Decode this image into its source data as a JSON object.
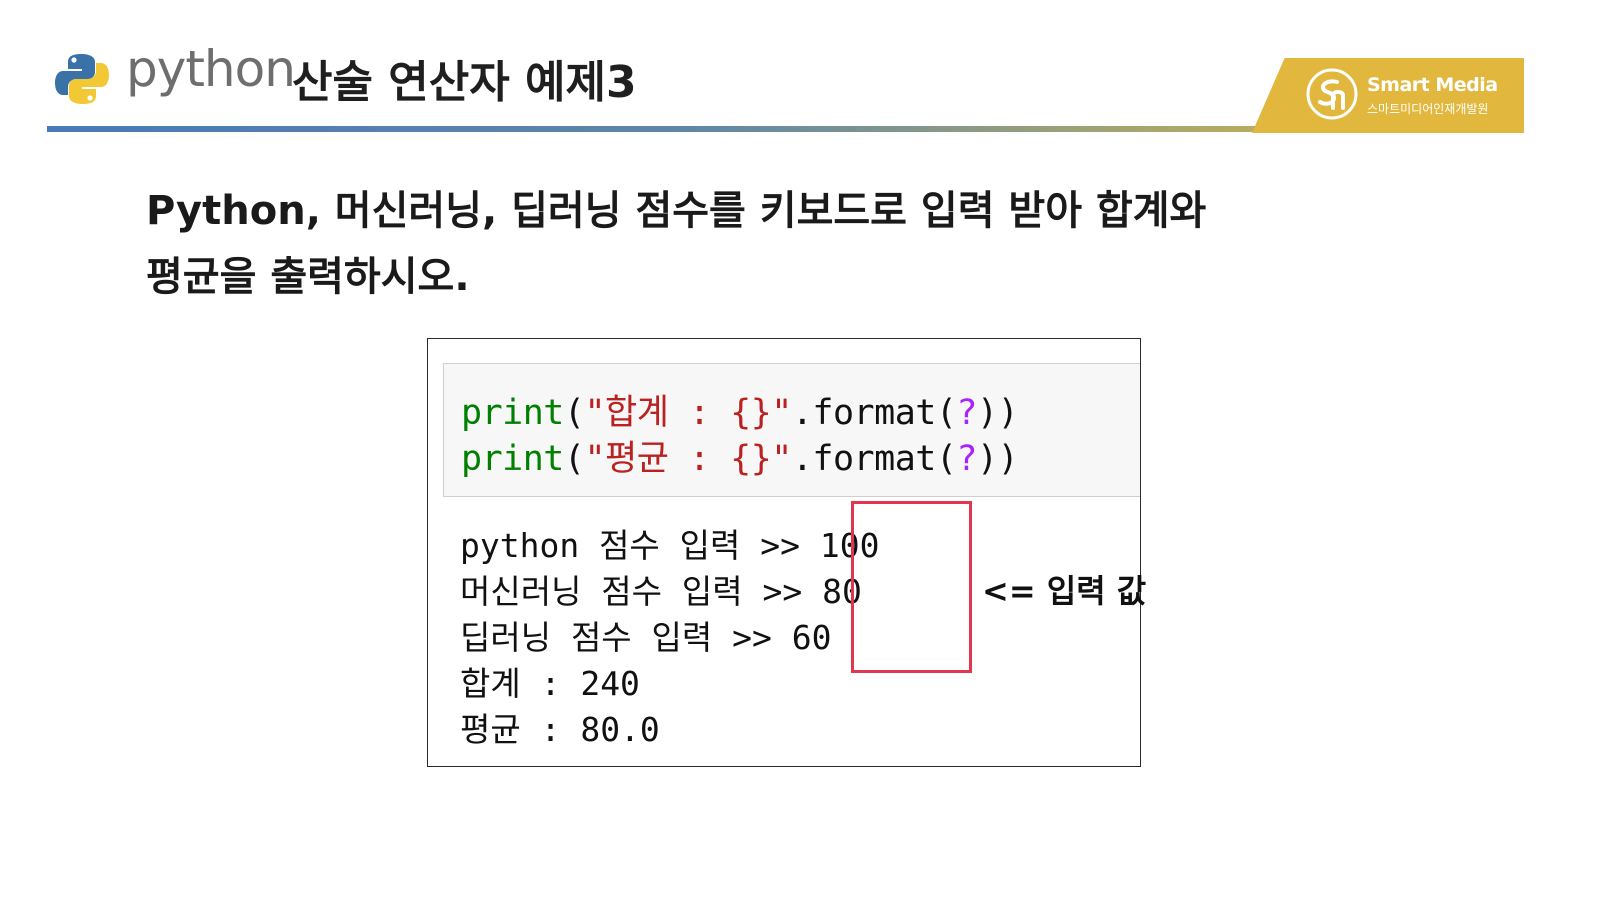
{
  "header": {
    "python_word": "python",
    "title": "산술 연산자 예제3",
    "brand_name": "Smart Media",
    "brand_sub": "스마트미디어인재개발원"
  },
  "question": {
    "line1": "Python,  머신러닝, 딥러닝 점수를 키보드로 입력 받아 합계와",
    "line2": "평균을 출력하시오."
  },
  "code": [
    {
      "fn": "print",
      "open": "(",
      "str": "\"합계 : {}\"",
      "dot": ".format(",
      "arg": "?",
      "close": "))"
    },
    {
      "fn": "print",
      "open": "(",
      "str": "\"평균 : {}\"",
      "dot": ".format(",
      "arg": "?",
      "close": "))"
    }
  ],
  "output": [
    "python 점수 입력 >> 100",
    "머신러닝 점수 입력 >> 80",
    "딥러닝 점수 입력 >> 60",
    "합계 : 240",
    "평균 : 80.0"
  ],
  "annotation": "<= 입력 값",
  "colors": {
    "accent_blue": "#4a78b8",
    "accent_gold": "#e2b73d",
    "highlight_red": "#e0364f",
    "code_green": "#008000",
    "code_red": "#ba2121",
    "code_purple": "#aa22ff"
  }
}
